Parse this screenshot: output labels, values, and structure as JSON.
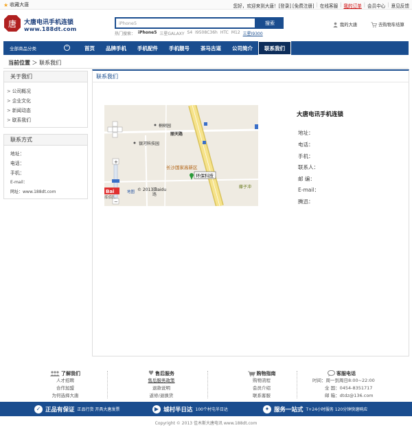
{
  "topbar": {
    "favorite": "收藏大唐",
    "greeting": "您好，欢迎来到大唐！[登录] [免费注册]",
    "online_service": "在线客服",
    "my_orders": "我的订单",
    "member_center": "会员中心",
    "feedback": "意见反馈"
  },
  "header": {
    "logo_glyph": "唐",
    "brand": "大唐电讯手机连锁",
    "domain": "www.188dt.com",
    "search_value": "iPhone5",
    "search_button": "搜索",
    "hot_label": "热门搜索：",
    "hot_items": [
      "iPhone5",
      "三星GALAXY",
      "S4",
      "I9508C36h",
      "HTC",
      "M12"
    ],
    "hot_highlight": "三星I9300",
    "my_tang": "我的大唐",
    "cart": "去购物车结算"
  },
  "nav": {
    "all_categories": "全部商品分类",
    "chevron": "⌃",
    "items": [
      "首页",
      "品牌手机",
      "手机配件",
      "手机靓号",
      "茶马古道",
      "公司简介",
      "联系我们"
    ]
  },
  "breadcrumb": {
    "label": "当前位置",
    "sep": "＞",
    "current": "联系我们"
  },
  "sidebar": {
    "about_title": "关于我们",
    "about_items": [
      "公司概况",
      "企业文化",
      "新闻动态",
      "联系我们"
    ],
    "contact_title": "联系方式",
    "contact_items": [
      "地址：",
      "电话：",
      "手机：",
      "E-mail：",
      "网址：www.188dt.com"
    ]
  },
  "main": {
    "title": "联系我们",
    "company": "大唐电讯手机连锁",
    "info": [
      "地址：",
      "电话：",
      "手机：",
      "联系人：",
      "邮  编：",
      "E-mail：",
      "腾迅："
    ]
  },
  "map": {
    "labels": {
      "tongshu": "桐树园",
      "lijian": "丽天路",
      "yinhe": "银河科技园",
      "changsha": "长沙国家高新区",
      "marker": "环保科技",
      "lizi": "藤子冲",
      "copyright": "© 2013 Baidu",
      "baidu": "Bai",
      "du": "地图",
      "zhi": "汇",
      "lu": "路",
      "pai": "挥佰园"
    },
    "colors": {
      "road": "#f6e38b",
      "roadedge": "#d9c25a",
      "marker": "#2a9a3a"
    }
  },
  "footer": {
    "cols": [
      {
        "title": "了解我们",
        "items": [
          "人才招聘",
          "合作加盟",
          "为何选择大唐"
        ]
      },
      {
        "title": "售后服务",
        "items": [
          "售后服务政策",
          "退款说明",
          "返修/退换货"
        ]
      },
      {
        "title": "购物指南",
        "items": [
          "购物流程",
          "会员介绍",
          "联系客服"
        ]
      },
      {
        "title": "客服电话",
        "items": [
          "时间：周一到周日8:00~22:00",
          "全  国：0454-8351717",
          "邮  箱：dtdz@136.com"
        ]
      }
    ],
    "band": [
      {
        "icon": "✓",
        "big": "正品有保证",
        "sm": "正品行货  开具大唐发票"
      },
      {
        "icon": "▶",
        "big": "城村半日达",
        "sm": "100个村屯半日达"
      },
      {
        "icon": "✦",
        "big": "服务一站式",
        "sm": "T+24小时服务  120分钟快速响应"
      }
    ],
    "copyright": "Copyright © 2013  佳木斯大唐电讯 www.188dt.com"
  }
}
